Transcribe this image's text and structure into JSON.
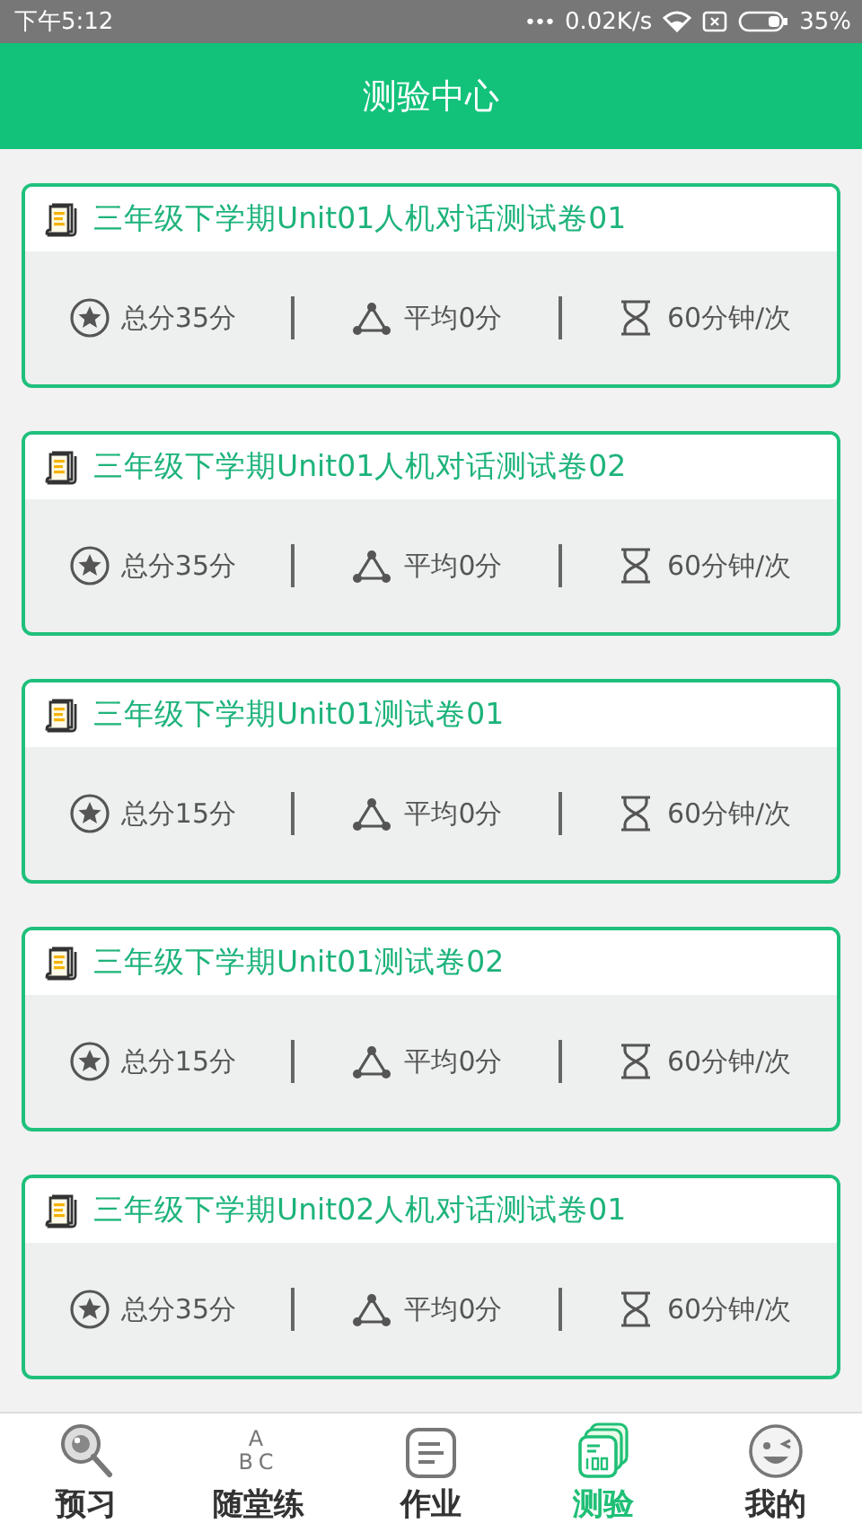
{
  "status_bar": {
    "time": "下午5:12",
    "dots": "•••",
    "speed": "0.02K/s",
    "battery": "35%"
  },
  "header": {
    "title": "测验中心"
  },
  "tests": [
    {
      "title": "三年级下学期Unit01人机对话测试卷01",
      "total": "总分35分",
      "average": "平均0分",
      "duration": "60分钟/次"
    },
    {
      "title": "三年级下学期Unit01人机对话测试卷02",
      "total": "总分35分",
      "average": "平均0分",
      "duration": "60分钟/次"
    },
    {
      "title": "三年级下学期Unit01测试卷01",
      "total": "总分15分",
      "average": "平均0分",
      "duration": "60分钟/次"
    },
    {
      "title": "三年级下学期Unit01测试卷02",
      "total": "总分15分",
      "average": "平均0分",
      "duration": "60分钟/次"
    },
    {
      "title": "三年级下学期Unit02人机对话测试卷01",
      "total": "总分35分",
      "average": "平均0分",
      "duration": "60分钟/次"
    }
  ],
  "tab_bar": [
    {
      "kind": "preview",
      "label": "预习",
      "selected": false
    },
    {
      "kind": "letters",
      "label": "随堂练",
      "selected": false,
      "icon_text": [
        "A",
        "BC"
      ]
    },
    {
      "kind": "homework",
      "label": "作业",
      "selected": false
    },
    {
      "kind": "test",
      "label": "测验",
      "selected": true
    },
    {
      "kind": "mine",
      "label": "我的",
      "selected": false
    }
  ]
}
